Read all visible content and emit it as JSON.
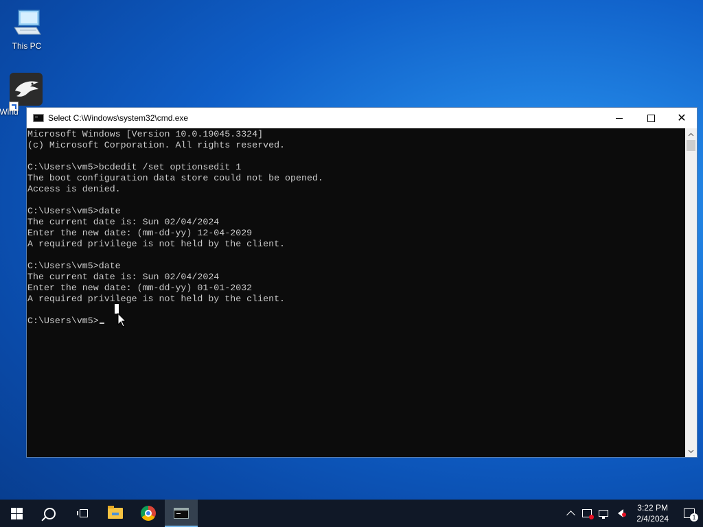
{
  "desktop": {
    "icons": [
      {
        "label": "This PC",
        "icon": "computer-icon"
      },
      {
        "label": "Wind",
        "icon": "eagle-app-icon"
      }
    ]
  },
  "window": {
    "title": "Select C:\\Windows\\system32\\cmd.exe",
    "minimize_symbol": "",
    "maximize_symbol": "",
    "close_symbol": "✕"
  },
  "console": {
    "lines": [
      "Microsoft Windows [Version 10.0.19045.3324]",
      "(c) Microsoft Corporation. All rights reserved.",
      "",
      "C:\\Users\\vm5>bcdedit /set optionsedit 1",
      "The boot configuration data store could not be opened.",
      "Access is denied.",
      "",
      "C:\\Users\\vm5>date",
      "The current date is: Sun 02/04/2024",
      "Enter the new date: (mm-dd-yy) 12-04-2029",
      "A required privilege is not held by the client.",
      "",
      "C:\\Users\\vm5>date",
      "The current date is: Sun 02/04/2024",
      "Enter the new date: (mm-dd-yy) 01-01-2032",
      "A required privilege is not held by the client.",
      ""
    ],
    "prompt": "C:\\Users\\vm5>"
  },
  "taskbar": {
    "pinned": [
      {
        "name": "start-button",
        "icon": "windows-logo-icon"
      },
      {
        "name": "search-button",
        "icon": "search-icon"
      },
      {
        "name": "task-view-button",
        "icon": "task-view-icon"
      },
      {
        "name": "file-explorer-button",
        "icon": "folder-icon"
      },
      {
        "name": "chrome-button",
        "icon": "chrome-icon"
      },
      {
        "name": "cmd-button",
        "icon": "cmd-icon",
        "active": true
      }
    ],
    "clock": {
      "time": "3:22 PM",
      "date": "2/4/2024"
    },
    "notifications_count": "1"
  }
}
